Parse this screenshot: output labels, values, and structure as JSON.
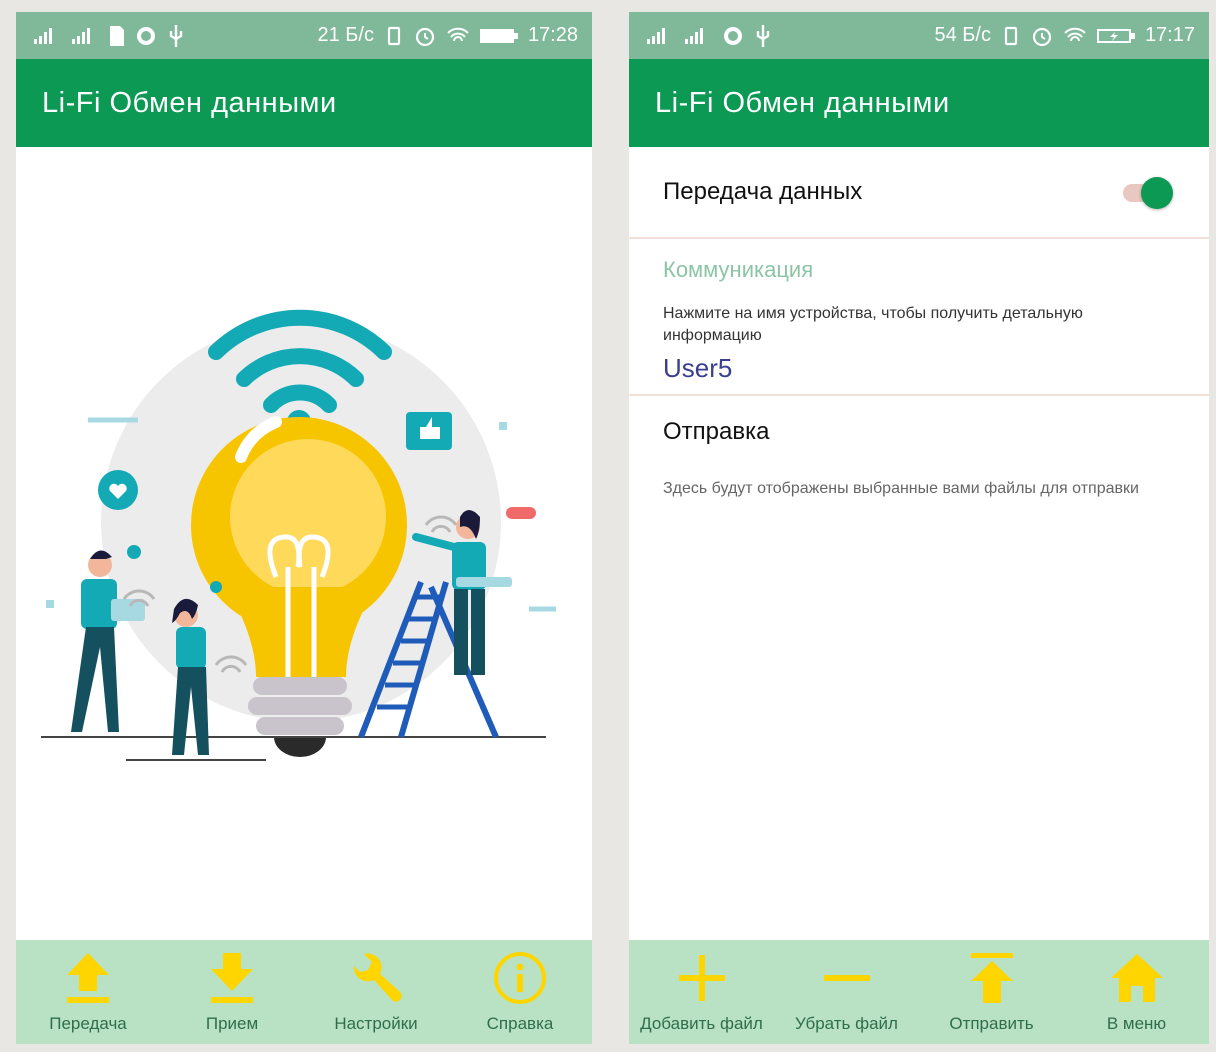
{
  "left": {
    "status": {
      "speed": "21 Б/с",
      "time": "17:28"
    },
    "appbar": {
      "title": "Li-Fi  Обмен данными"
    },
    "nav": [
      {
        "label": "Передача",
        "icon": "upload-arrow-icon"
      },
      {
        "label": "Прием",
        "icon": "download-arrow-icon"
      },
      {
        "label": "Настройки",
        "icon": "wrench-icon"
      },
      {
        "label": "Справка",
        "icon": "info-icon"
      }
    ]
  },
  "right": {
    "status": {
      "speed": "54 Б/с",
      "time": "17:17"
    },
    "appbar": {
      "title": "Li-Fi  Обмен данными"
    },
    "transfer": {
      "label": "Передача данных",
      "enabled": true
    },
    "communication": {
      "title": "Коммуникация",
      "description": "Нажмите на имя устройства, чтобы получить детальную информацию",
      "user": "User5"
    },
    "sending": {
      "title": "Отправка",
      "description": "Здесь будут отображены выбранные вами файлы для отправки"
    },
    "nav": [
      {
        "label": "Добавить файл",
        "icon": "plus-icon"
      },
      {
        "label": "Убрать файл",
        "icon": "minus-icon"
      },
      {
        "label": "Отправить",
        "icon": "send-upload-icon"
      },
      {
        "label": "В меню",
        "icon": "home-icon"
      }
    ]
  },
  "colors": {
    "primary": "#0b9954",
    "statusbar": "#7fb99a",
    "nav_bg": "#b9e2c4",
    "nav_icon": "#ffd500"
  }
}
